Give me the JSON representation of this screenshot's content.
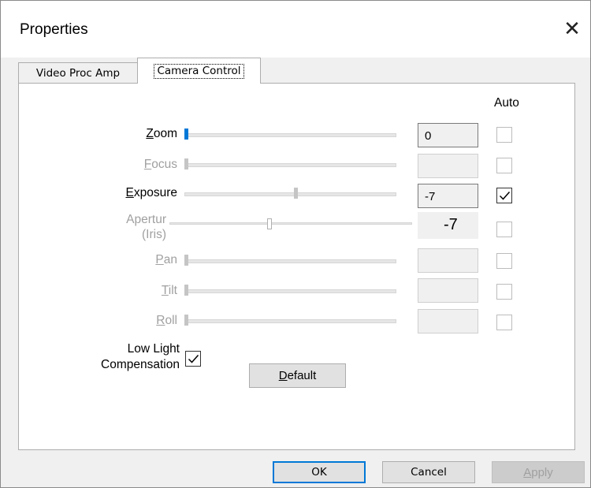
{
  "window": {
    "title": "Properties",
    "close_glyph": "✕"
  },
  "tabs": [
    {
      "label": "Video Proc Amp",
      "selected": false
    },
    {
      "label": "Camera Control",
      "selected": true
    }
  ],
  "auto_header": "Auto",
  "controls": [
    {
      "key": "Z",
      "rest": "oom",
      "value": "0",
      "enabled": true,
      "auto": false,
      "auto_enabled": true,
      "level": 0.0
    },
    {
      "key": "F",
      "rest": "ocus",
      "value": "",
      "enabled": false,
      "auto": false,
      "auto_enabled": false,
      "level": 0.0
    },
    {
      "key": "E",
      "rest": "xposure",
      "value": "-7",
      "enabled": true,
      "auto": true,
      "auto_enabled": true,
      "level": 0.54
    },
    {
      "line1": "Apertur",
      "line2": "(Iris)",
      "value": "-7",
      "enabled": false,
      "auto": false,
      "auto_enabled": false,
      "level": 0.42
    },
    {
      "key": "P",
      "rest": "an",
      "value": "",
      "enabled": false,
      "auto": false,
      "auto_enabled": false,
      "level": 0.0
    },
    {
      "key": "T",
      "rest": "ilt",
      "value": "",
      "enabled": false,
      "auto": false,
      "auto_enabled": false,
      "level": 0.0
    },
    {
      "key": "R",
      "rest": "oll",
      "value": "",
      "enabled": false,
      "auto": false,
      "auto_enabled": false,
      "level": 0.0
    }
  ],
  "low_light": {
    "line1": "Low Light",
    "line2": "Compensation",
    "checked": true
  },
  "buttons": {
    "default_key": "D",
    "default_rest": "efault",
    "ok": "OK",
    "cancel": "Cancel",
    "apply_key": "A",
    "apply_rest": "pply"
  }
}
